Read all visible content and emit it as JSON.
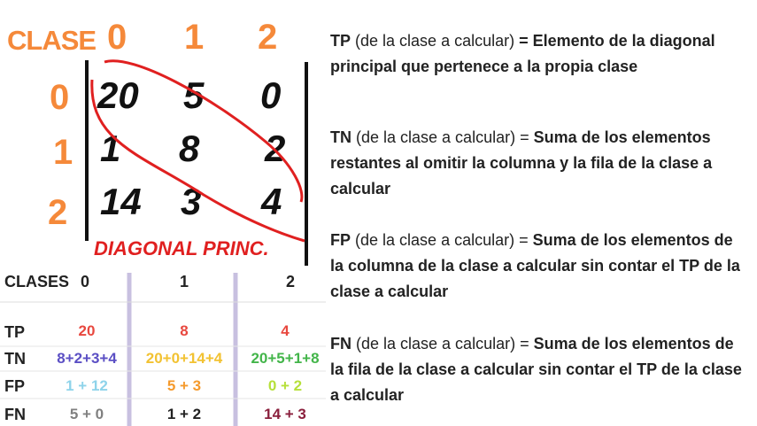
{
  "matrix": {
    "clase_label": "CLASE",
    "col_headers": [
      "0",
      "1",
      "2"
    ],
    "row_headers": [
      "0",
      "1",
      "2"
    ],
    "cells": [
      [
        "20",
        "5",
        "0"
      ],
      [
        "1",
        "8",
        "2"
      ],
      [
        "14",
        "3",
        "4"
      ]
    ],
    "diagonal_label": "DIAGONAL PRINC."
  },
  "table": {
    "header_label": "CLASES",
    "col_headers": [
      "0",
      "1",
      "2"
    ],
    "rows": [
      {
        "label": "TP",
        "values": [
          "20",
          "8",
          "4"
        ],
        "colors": [
          "#e8483f",
          "#e8483f",
          "#e8483f"
        ]
      },
      {
        "label": "TN",
        "values": [
          "8+2+3+4",
          "20+0+14+4",
          "20+5+1+8"
        ],
        "colors": [
          "#5b4fc4",
          "#f2c232",
          "#43b54a"
        ]
      },
      {
        "label": "FP",
        "values": [
          "1 + 12",
          "5 + 3",
          "0 + 2"
        ],
        "colors": [
          "#8ed3ea",
          "#f59a2c",
          "#b6e03a"
        ]
      },
      {
        "label": "FN",
        "values": [
          "5 + 0",
          "1 + 2",
          "14 + 3"
        ],
        "colors": [
          "#808080",
          "#222222",
          "#8a1f3c"
        ]
      }
    ]
  },
  "definitions": [
    {
      "term": "TP",
      "paren": " (de la clase a calcular) ",
      "rest": "= Elemento de la diagonal principal que pertenece a la propia clase"
    },
    {
      "term": "TN",
      "paren": " (de la clase a calcular) = ",
      "rest": "Suma de los elementos restantes al omitir la columna y la fila de la clase a calcular"
    },
    {
      "term": "FP",
      "paren": " (de la clase a calcular) = ",
      "rest": "Suma de los elementos de la columna de la clase a calcular sin contar el TP de la clase a calcular"
    },
    {
      "term": "FN",
      "paren": " (de la clase a calcular) = ",
      "rest": "Suma de los elementos de la fila de la clase a calcular sin contar el TP de la clase a calcular"
    }
  ],
  "colors": {
    "accent_orange": "#f5893a",
    "diagonal_red": "#e02020",
    "divider_purple": "#c8c0e0"
  }
}
